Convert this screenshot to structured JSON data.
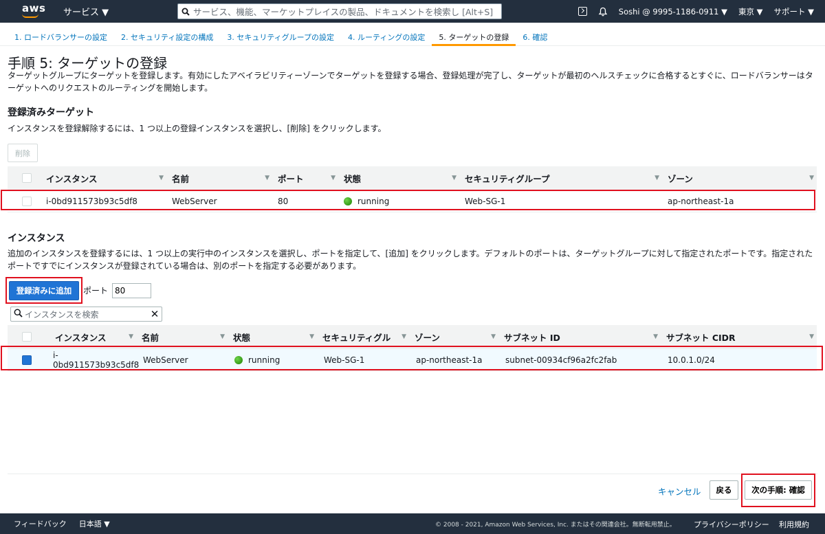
{
  "nav": {
    "logo": "aws",
    "services": "サービス ▼",
    "search_placeholder": "サービス、機能、マーケットプレイスの製品、ドキュメントを検索し [Alt+S]",
    "account": "Soshi @ 9995-1186-0911 ▼",
    "region": "東京 ▼",
    "support": "サポート ▼"
  },
  "steps": [
    {
      "label": "1. ロードバランサーの設定"
    },
    {
      "label": "2. セキュリティ設定の構成"
    },
    {
      "label": "3. セキュリティグループの設定"
    },
    {
      "label": "4. ルーティングの設定"
    },
    {
      "label": "5. ターゲットの登録"
    },
    {
      "label": "6. 確認"
    }
  ],
  "page": {
    "title": "手順 5: ターゲットの登録",
    "description": "ターゲットグループにターゲットを登録します。有効にしたアベイラビリティーゾーンでターゲットを登録する場合、登録処理が完了し、ターゲットが最初のヘルスチェックに合格するとすぐに、ロードバランサーはターゲットへのリクエストのルーティングを開始します。"
  },
  "registered": {
    "heading": "登録済みターゲット",
    "description": "インスタンスを登録解除するには、1 つ以上の登録インスタンスを選択し、[削除] をクリックします。",
    "delete_label": "削除",
    "columns": [
      "インスタンス",
      "名前",
      "ポート",
      "状態",
      "セキュリティグループ",
      "ゾーン"
    ],
    "rows": [
      {
        "instance": "i-0bd911573b93c5df8",
        "name": "WebServer",
        "port": "80",
        "state": "running",
        "sg": "Web-SG-1",
        "zone": "ap-northeast-1a"
      }
    ]
  },
  "instances": {
    "heading": "インスタンス",
    "description": "追加のインスタンスを登録するには、1 つ以上の実行中のインスタンスを選択し、ポートを指定して、[追加] をクリックします。デフォルトのポートは、ターゲットグループに対して指定されたポートです。指定されたポートですでにインスタンスが登録されている場合は、別のポートを指定する必要があります。",
    "add_label": "登録済みに追加",
    "port_label": "ポート",
    "port_value": "80",
    "filter_placeholder": "インスタンスを検索",
    "columns": [
      "インスタンス",
      "名前",
      "状態",
      "セキュリティグル",
      "ゾーン",
      "サブネット ID",
      "サブネット CIDR"
    ],
    "rows": [
      {
        "instance": "i-0bd911573b93c5df8",
        "name": "WebServer",
        "state": "running",
        "sg": "Web-SG-1",
        "zone": "ap-northeast-1a",
        "subnet": "subnet-00934cf96a2fc2fab",
        "cidr": "10.0.1.0/24"
      }
    ]
  },
  "actions": {
    "cancel": "キャンセル",
    "back": "戻る",
    "next": "次の手順: 確認"
  },
  "footer": {
    "feedback": "フィードバック",
    "language": "日本語 ▼",
    "copyright": "© 2008 - 2021, Amazon Web Services, Inc. またはその関連会社。無断転用禁止。",
    "privacy": "プライバシーポリシー",
    "terms": "利用規約"
  },
  "colors": {
    "nav_bg": "#232f3e",
    "link": "#0073bb",
    "primary_button": "#2074d5",
    "active_step": "#ff9900",
    "running": "#1d8102",
    "highlight": "#e0101e"
  }
}
